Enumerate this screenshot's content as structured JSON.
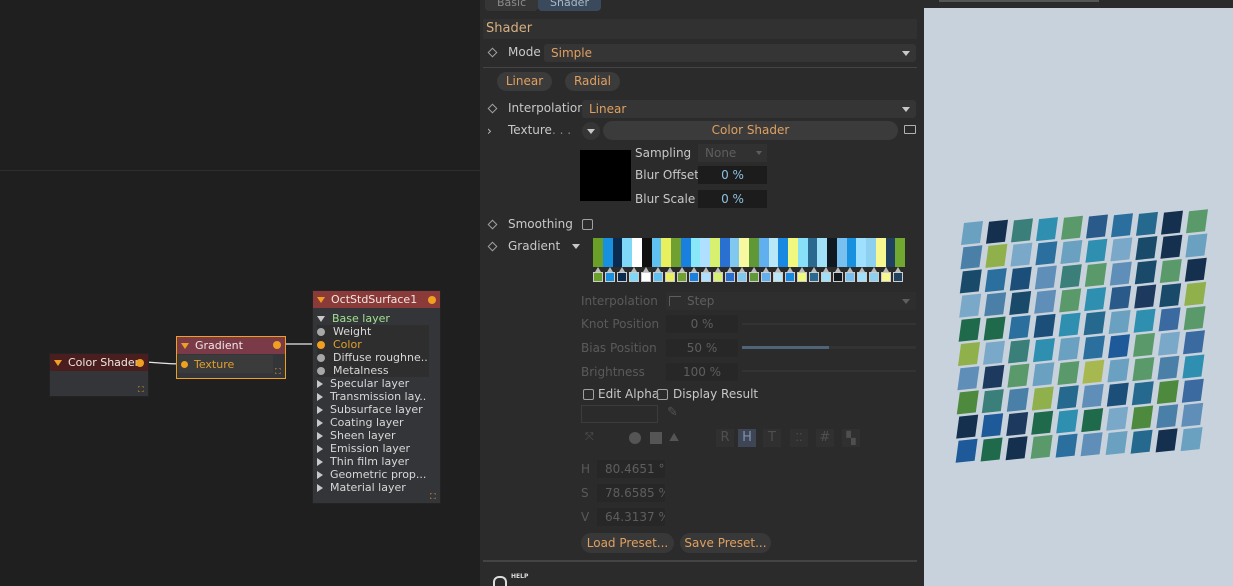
{
  "node_editor": {
    "color_shader_node": {
      "title": "Color Shader"
    },
    "gradient_node": {
      "title": "Gradient",
      "input": "Texture"
    },
    "oct_node": {
      "title": "OctStdSurface1",
      "base_group": "Base layer",
      "base_params": [
        "Weight",
        "Color",
        "Diffuse roughne..",
        "Metalness"
      ],
      "groups": [
        "Specular layer",
        "Transmission lay..",
        "Subsurface layer",
        "Coating layer",
        "Sheen layer",
        "Emission layer",
        "Thin film layer",
        "Geometric prop...",
        "Material layer"
      ]
    }
  },
  "attr": {
    "tabs": [
      "Basic",
      "Shader"
    ],
    "section_title": "Shader",
    "mode": {
      "label": "Mode",
      "value": "Simple"
    },
    "gradient_types": [
      "Linear",
      "Radial"
    ],
    "interpolation": {
      "label": "Interpolation",
      "value": "Linear"
    },
    "texture": {
      "label": "Texture",
      "dots": ". . .",
      "value": "Color Shader"
    },
    "sampling": {
      "label": "Sampling",
      "value": "None"
    },
    "blur_offset": {
      "label": "Blur Offset",
      "value": "0 %"
    },
    "blur_scale": {
      "label": "Blur Scale",
      "value": "0 %"
    },
    "smoothing": {
      "label": "Smoothing"
    },
    "gradient": {
      "label": "Gradient"
    },
    "knot": {
      "interpolation": {
        "label": "Interpolation",
        "value": "Step"
      },
      "knot_position": {
        "label": "Knot Position",
        "value": "0 %"
      },
      "bias_position": {
        "label": "Bias Position",
        "value": "50 %"
      },
      "brightness": {
        "label": "Brightness",
        "value": "100 %"
      }
    },
    "edit_alpha": "Edit Alpha",
    "display_result": "Display Result",
    "channel_letters": [
      "R",
      "H",
      "T"
    ],
    "hsv": [
      {
        "label": "H",
        "value": "80.4651 °"
      },
      {
        "label": "S",
        "value": "78.6585 %"
      },
      {
        "label": "V",
        "value": "64.3137 %"
      }
    ],
    "load_preset": "Load Preset...",
    "save_preset": "Save Preset...",
    "help": "HELP"
  },
  "colors": {
    "accent": "#e0a060",
    "node_header_red": "#8b3a3a",
    "port_orange": "#f0a020",
    "gradient_stops": [
      "#6aa028",
      "#1890e0",
      "#0a2a50",
      "#80d8f8",
      "#ffffff",
      "#101010",
      "#60c0f0",
      "#e8f060",
      "#70a030",
      "#1a80e0",
      "#88e8f8",
      "#b0e0ff",
      "#d8f070",
      "#2a70d0",
      "#80c8f0",
      "#f8f8a0",
      "#609838",
      "#60b0f0",
      "#b8e8f8",
      "#1888e0",
      "#f0f880",
      "#88e0f8",
      "#2a6890",
      "#a0e0f8",
      "#101820",
      "#78c0f0",
      "#1890e0",
      "#a0e0ff",
      "#8ed0f0",
      "#f8f890",
      "#204060",
      "#70a830"
    ]
  }
}
